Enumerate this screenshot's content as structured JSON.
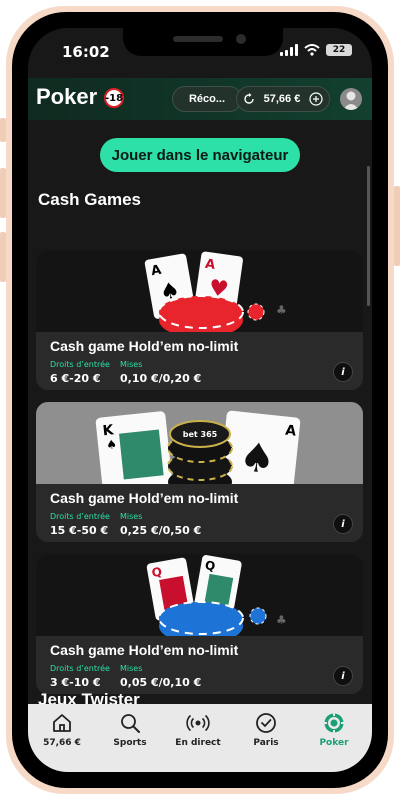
{
  "status_bar": {
    "time": "16:02",
    "battery": "22"
  },
  "header": {
    "brand": "Poker",
    "age_badge": "-18",
    "reconnect_label": "Réco...",
    "balance": "57,66 €"
  },
  "cta": {
    "label": "Jouer dans le navigateur"
  },
  "section": {
    "title": "Cash Games",
    "next_title": "Jeux Twister"
  },
  "cards": [
    {
      "title": "Cash game Hold’em no-limit",
      "entry_label": "Droits d’entrée",
      "entry_value": "6 €-20 €",
      "stakes_label": "Mises",
      "stakes_value": "0,10 €/0,20 €",
      "chip_color": "#e8242c",
      "info": "i"
    },
    {
      "title": "Cash game Hold’em no-limit",
      "entry_label": "Droits d’entrée",
      "entry_value": "15 €-50 €",
      "stakes_label": "Mises",
      "stakes_value": "0,25 €/0,50 €",
      "chip_color": "#111111",
      "chip_text": "bet 365",
      "info": "i"
    },
    {
      "title": "Cash game Hold’em no-limit",
      "entry_label": "Droits d’entrée",
      "entry_value": "3 €-10 €",
      "stakes_label": "Mises",
      "stakes_value": "0,05 €/0,10 €",
      "chip_color": "#1e73d6",
      "info": "i"
    }
  ],
  "bottom_nav": [
    {
      "label": "57,66 €",
      "icon": "home-icon"
    },
    {
      "label": "Sports",
      "icon": "search-icon"
    },
    {
      "label": "En direct",
      "icon": "live-icon"
    },
    {
      "label": "Paris",
      "icon": "check-circle-icon"
    },
    {
      "label": "Poker",
      "icon": "poker-chip-icon",
      "active": true
    }
  ],
  "colors": {
    "accent": "#2ce0a8",
    "header_bg": "#12402f",
    "page_bg": "#181818",
    "card_bg": "#2a2a2a"
  }
}
